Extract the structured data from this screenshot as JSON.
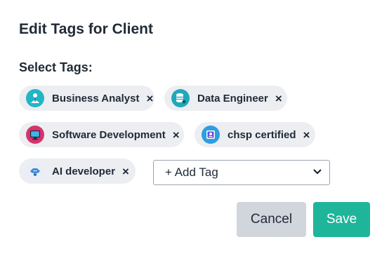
{
  "dialog": {
    "title": "Edit Tags for Client",
    "select_label": "Select Tags:"
  },
  "tags": [
    {
      "label": "Business Analyst",
      "icon": "business-analyst-icon",
      "color": "#22b5c4",
      "remove": "×"
    },
    {
      "label": "Data Engineer",
      "icon": "database-icon",
      "color": "#1fa9b9",
      "remove": "×"
    },
    {
      "label": "Software Development",
      "icon": "monitor-code-icon",
      "color": "#d6336c",
      "remove": "×"
    },
    {
      "label": "chsp certified",
      "icon": "certificate-icon",
      "color": "#2b9fe0",
      "remove": "×"
    },
    {
      "label": "AI developer",
      "icon": "ai-robot-icon",
      "color": "#e9eef6",
      "remove": "×"
    }
  ],
  "add_tag": {
    "selected": "+ Add Tag"
  },
  "actions": {
    "cancel_label": "Cancel",
    "save_label": "Save"
  }
}
